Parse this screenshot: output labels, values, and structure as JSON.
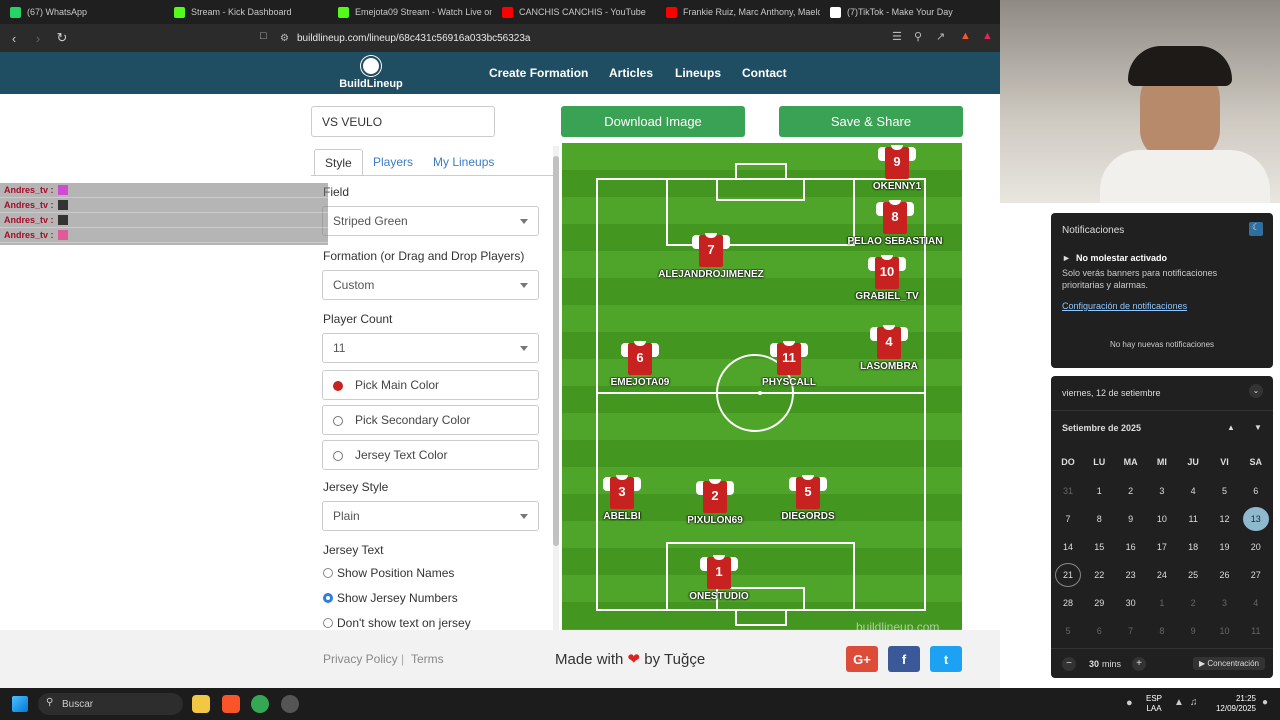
{
  "browser": {
    "tabs": [
      {
        "label": "(67) WhatsApp",
        "color": "#25d366"
      },
      {
        "label": "Stream - Kick Dashboard",
        "color": "#53fc18"
      },
      {
        "label": "Emejota09 Stream - Watch Live on K",
        "color": "#53fc18"
      },
      {
        "label": "CANCHIS CANCHIS - YouTube",
        "color": "#ff0000"
      },
      {
        "label": "Frankie Ruiz, Marc Anthony, Maelo R",
        "color": "#ff0000"
      },
      {
        "label": "(7)TikTok - Make Your Day",
        "color": "#ffffff"
      }
    ],
    "url": "buildlineup.com/lineup/68c431c56916a033bc56323a"
  },
  "site": {
    "logo": "BuildLineup",
    "nav": [
      "Create Formation",
      "Articles",
      "Lineups",
      "Contact"
    ]
  },
  "lineup_title": "VS VEULO",
  "buttons": {
    "download": "Download Image",
    "save": "Save & Share"
  },
  "panel": {
    "tabs": [
      "Style",
      "Players",
      "My Lineups"
    ],
    "field_label": "Field",
    "field_value": "Striped Green",
    "formation_label": "Formation (or Drag and Drop Players)",
    "formation_value": "Custom",
    "count_label": "Player Count",
    "count_value": "11",
    "main_color": "Pick Main Color",
    "secondary_color": "Pick Secondary Color",
    "text_color": "Jersey Text Color",
    "jersey_style_label": "Jersey Style",
    "jersey_style_value": "Plain",
    "jersey_text_label": "Jersey Text",
    "opt_positions": "Show Position Names",
    "opt_numbers": "Show Jersey Numbers",
    "opt_none": "Don't show text on jersey",
    "main_color_hex": "#c7221f"
  },
  "players": [
    {
      "num": "9",
      "name": "OKENNY1"
    },
    {
      "num": "8",
      "name": "PELAO SEBASTIAN"
    },
    {
      "num": "10",
      "name": "GRABIEL_TV"
    },
    {
      "num": "4",
      "name": "LASOMBRA"
    },
    {
      "num": "7",
      "name": "ALEJANDROJIMENEZ"
    },
    {
      "num": "6",
      "name": "EMEJOTA09"
    },
    {
      "num": "11",
      "name": "PHYSCALL"
    },
    {
      "num": "3",
      "name": "ABELBI"
    },
    {
      "num": "2",
      "name": "PIXULON69"
    },
    {
      "num": "5",
      "name": "DIEGORDS"
    },
    {
      "num": "1",
      "name": "ONESTUDIO"
    }
  ],
  "watermark": "buildlineup.com",
  "footer": {
    "privacy": "Privacy Policy",
    "sep": "|",
    "terms": "Terms",
    "made": "Made with",
    "by": "by Tuğçe",
    "gplus": "G+",
    "fb": "f",
    "tw": "t"
  },
  "chat": [
    "Andres_tv :",
    "Andres_tv :",
    "Andres_tv :",
    "Andres_tv :"
  ],
  "notifications": {
    "title": "Notificaciones",
    "dnd_title": "No molestar activado",
    "dnd_text": "Solo verás banners para notificaciones prioritarias y alarmas.",
    "settings_link": "Configuración de notificaciones",
    "empty": "No hay nuevas notificaciones"
  },
  "calendar": {
    "date_header": "viernes, 12 de setiembre",
    "month": "Setiembre de 2025",
    "weekdays": [
      "DO",
      "LU",
      "MA",
      "MI",
      "JU",
      "VI",
      "SA"
    ],
    "days": [
      "31",
      "1",
      "2",
      "3",
      "4",
      "5",
      "6",
      "7",
      "8",
      "9",
      "10",
      "11",
      "12",
      "13",
      "14",
      "15",
      "16",
      "17",
      "18",
      "19",
      "20",
      "21",
      "22",
      "23",
      "24",
      "25",
      "26",
      "27",
      "28",
      "29",
      "30",
      "1",
      "2",
      "3",
      "4",
      "5",
      "6",
      "7",
      "8",
      "9",
      "10",
      "11"
    ],
    "focus_minutes": "30",
    "focus_unit": "mins",
    "focus_button": "Concentración"
  },
  "taskbar": {
    "search": "Buscar",
    "lang": "ESP",
    "lang2": "LAA",
    "time": "21:25",
    "date": "12/09/2025"
  }
}
